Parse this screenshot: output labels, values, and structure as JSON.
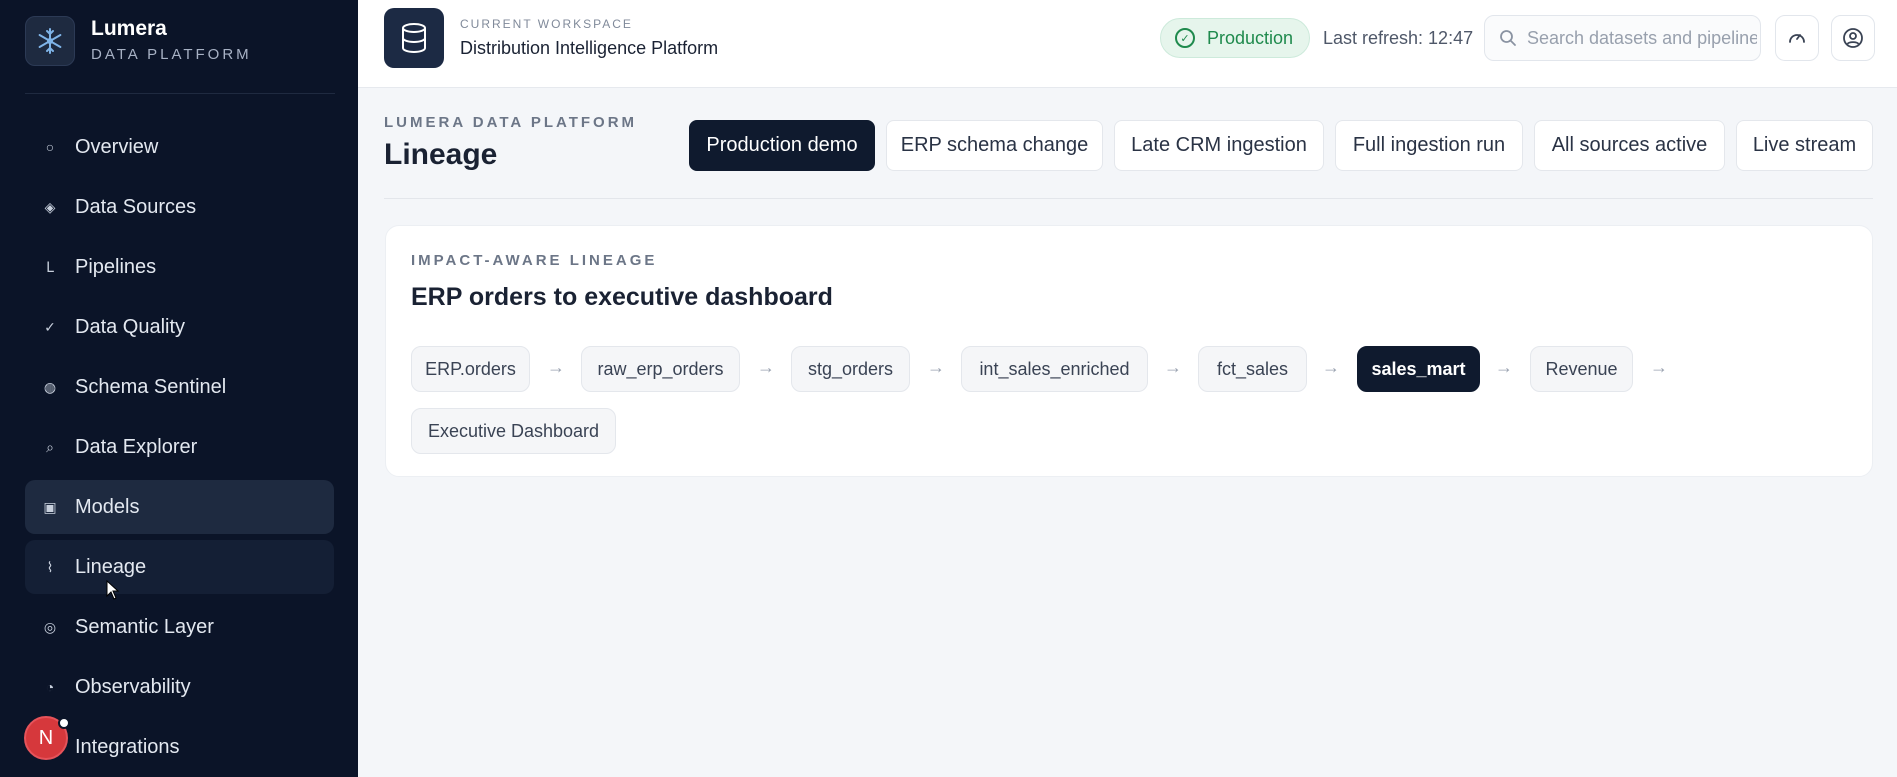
{
  "brand": {
    "name": "Lumera",
    "subtitle": "DATA PLATFORM"
  },
  "sidebar": {
    "items": [
      {
        "label": "Overview",
        "icon": "circle-icon"
      },
      {
        "label": "Data Sources",
        "icon": "diamond-icon"
      },
      {
        "label": "Pipelines",
        "icon": "pipeline-icon"
      },
      {
        "label": "Data Quality",
        "icon": "check-icon"
      },
      {
        "label": "Schema Sentinel",
        "icon": "shield-dot-icon"
      },
      {
        "label": "Data Explorer",
        "icon": "search-icon"
      },
      {
        "label": "Models",
        "icon": "square-icon",
        "state": "active"
      },
      {
        "label": "Lineage",
        "icon": "lineage-icon",
        "state": "hover"
      },
      {
        "label": "Semantic Layer",
        "icon": "target-icon"
      },
      {
        "label": "Observability",
        "icon": "pie-icon"
      },
      {
        "label": "Integrations",
        "icon": "plug-icon"
      }
    ],
    "avatar_initial": "N"
  },
  "header": {
    "workspace_label": "CURRENT WORKSPACE",
    "workspace_name": "Distribution Intelligence Platform",
    "status": "Production",
    "last_refresh": "Last refresh: 12:47",
    "search_placeholder": "Search datasets and pipelines"
  },
  "main": {
    "eyebrow": "LUMERA DATA PLATFORM",
    "title": "Lineage",
    "scenarios": [
      {
        "label": "Production demo",
        "active": true
      },
      {
        "label": "ERP schema change"
      },
      {
        "label": "Late CRM ingestion"
      },
      {
        "label": "Full ingestion run"
      },
      {
        "label": "All sources active"
      },
      {
        "label": "Live stream"
      }
    ],
    "card": {
      "eyebrow": "IMPACT-AWARE LINEAGE",
      "title": "ERP orders to executive dashboard",
      "nodes": [
        {
          "label": "ERP.orders"
        },
        {
          "label": "raw_erp_orders"
        },
        {
          "label": "stg_orders"
        },
        {
          "label": "int_sales_enriched"
        },
        {
          "label": "fct_sales"
        },
        {
          "label": "sales_mart",
          "active": true
        },
        {
          "label": "Revenue"
        },
        {
          "label": "Executive Dashboard"
        }
      ]
    }
  },
  "colors": {
    "sidebar_bg": "#0b1428",
    "accent_dark": "#0f1a2e",
    "status_green": "#1f8a4d",
    "avatar_red": "#d6383c"
  }
}
